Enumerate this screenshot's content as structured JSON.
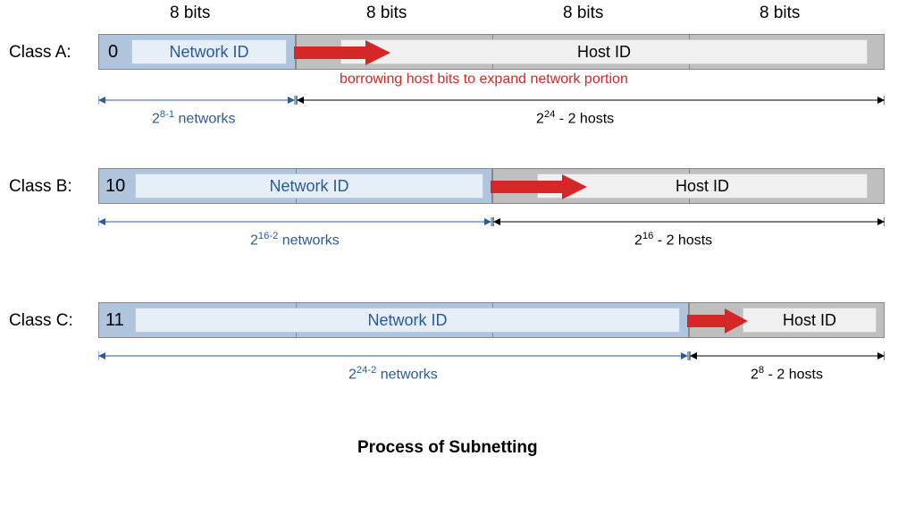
{
  "chart_data": {
    "type": "table",
    "title": "Process of Subnetting",
    "columns_header": "8 bits",
    "note": "borrowing host bits to expand network portion",
    "classes": [
      {
        "name": "Class A",
        "prefix_bits": "0",
        "network_octets": 1,
        "host_octets": 3,
        "networks_formula": "2^(8-1) networks",
        "hosts_formula": "2^24 - 2 hosts"
      },
      {
        "name": "Class B",
        "prefix_bits": "10",
        "network_octets": 2,
        "host_octets": 2,
        "networks_formula": "2^(16-2) networks",
        "hosts_formula": "2^16 - 2 hosts"
      },
      {
        "name": "Class C",
        "prefix_bits": "11",
        "network_octets": 3,
        "host_octets": 1,
        "networks_formula": "2^(24-2) networks",
        "hosts_formula": "2^8 - 2 hosts"
      }
    ]
  },
  "labels": {
    "bits": "8 bits",
    "classA": "Class A:",
    "classB": "Class B:",
    "classC": "Class C:",
    "networkId": "Network ID",
    "hostId": "Host ID",
    "prefixA": "0",
    "prefixB": "10",
    "prefixC": "11",
    "borrow": "borrowing host bits to expand network portion",
    "netA_html": "2<sup>8-1</sup> networks",
    "hostA_html": "2<sup>24</sup> - 2 hosts",
    "netB_html": "2<sup>16-2</sup> networks",
    "hostB_html": "2<sup>16</sup> - 2 hosts",
    "netC_html": "2<sup>24-2</sup> networks",
    "hostC_html": "2<sup>8</sup> - 2 hosts",
    "caption": "Process of Subnetting"
  }
}
